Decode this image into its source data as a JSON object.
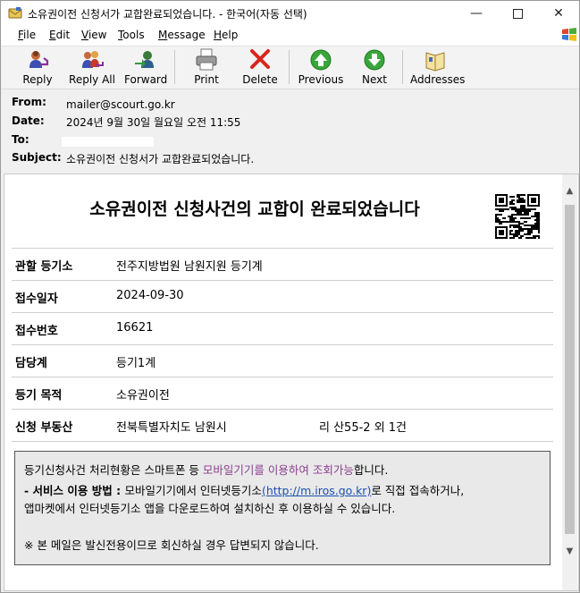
{
  "window": {
    "title": "소유권이전 신청서가 교합완료되었습니다. - 한국어(자동 선택)",
    "controls": {
      "minimize": "—",
      "close": "✕"
    }
  },
  "menu": {
    "file": {
      "acc": "F",
      "rest": "ile"
    },
    "edit": {
      "acc": "E",
      "rest": "dit"
    },
    "view": {
      "acc": "V",
      "rest": "iew"
    },
    "tools": {
      "acc": "T",
      "rest": "ools"
    },
    "message": {
      "acc": "M",
      "rest": "essage"
    },
    "help": {
      "acc": "H",
      "rest": "elp"
    }
  },
  "toolbar": {
    "reply": "Reply",
    "reply_all": "Reply All",
    "forward": "Forward",
    "print": "Print",
    "delete": "Delete",
    "previous": "Previous",
    "next": "Next",
    "addresses": "Addresses"
  },
  "headers": {
    "from_label": "From:",
    "from": "mailer@scourt.go.kr",
    "date_label": "Date:",
    "date": "2024년 9월 30일 월요일 오전 11:55",
    "to_label": "To:",
    "subject_label": "Subject:",
    "subject": "소유권이전 신청서가 교합완료되었습니다."
  },
  "mail": {
    "title": "소유권이전 신청사건의 교합이 완료되었습니다",
    "rows": [
      {
        "label": "관할 등기소",
        "value": "전주지방법원 남원지원 등기계"
      },
      {
        "label": "접수일자",
        "value": "2024-09-30"
      },
      {
        "label": "접수번호",
        "value": "16621"
      },
      {
        "label": "담당계",
        "value": "등기1계"
      },
      {
        "label": "등기 목적",
        "value": "소유권이전"
      },
      {
        "label": "신청 부동산",
        "value": "전북특별자치도 남원시",
        "value2": "리 산55-2 외 1건"
      }
    ],
    "notice": {
      "line1_a": "등기신청사건 처리현황은 스마트폰 등 ",
      "line1_b": "모바일기기를 이용하여 조회가능",
      "line1_c": "합니다.",
      "line2_a": "- 서비스 이용 방법 : ",
      "line2_b": "모바일기기에서 인터넷등기소",
      "line2_link": "(http://m.iros.go.kr)",
      "line2_c": "로 직접 접속하거나,",
      "line3": "앱마켓에서 인터넷등기소 앱을 다운로드하여 설치하신 후 이용하실 수 있습니다.",
      "line4": "※ 본 메일은 발신전용이므로 회신하실 경우 답변되지 않습니다."
    }
  },
  "colors": {
    "accent_purple": "#8a3e8e",
    "link_blue": "#1a4fb0"
  }
}
